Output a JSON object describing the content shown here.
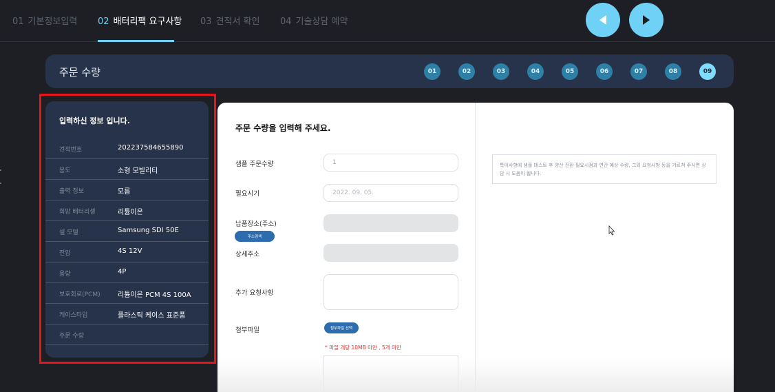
{
  "steps": [
    {
      "num": "01",
      "label": "기본정보입력"
    },
    {
      "num": "02",
      "label": "배터리팩 요구사항"
    },
    {
      "num": "03",
      "label": "견적서 확인"
    },
    {
      "num": "04",
      "label": "기술상담 예약"
    }
  ],
  "nav": {
    "prev_icon": "triangle-left-icon",
    "next_icon": "triangle-right-icon"
  },
  "section": {
    "title": "주문 수량",
    "pills": [
      "01",
      "02",
      "03",
      "04",
      "05",
      "06",
      "07",
      "08",
      "09"
    ],
    "active_pill": "09"
  },
  "info": {
    "title": "입력하신 정보 입니다.",
    "rows": [
      {
        "key": "견적번호",
        "value": "202237584655890"
      },
      {
        "key": "용도",
        "value": "소형 모빌리티"
      },
      {
        "key": "출력 정보",
        "value": "모름"
      },
      {
        "key": "희망 배터리셀",
        "value": "리튬이온"
      },
      {
        "key": "셀 모델",
        "value": "Samsung SDI 50E"
      },
      {
        "key": "전압",
        "value": "4S 12V"
      },
      {
        "key": "용량",
        "value": "4P"
      },
      {
        "key": "보호회로(PCM)",
        "value": "리튬이온 PCM 4S 100A"
      },
      {
        "key": "케이스타입",
        "value": "플라스틱 케이스 표준품"
      },
      {
        "key": "주문 수량",
        "value": ""
      }
    ]
  },
  "form": {
    "heading": "주문 수량을 입력해 주세요.",
    "sample_qty_label": "샘플 주문수량",
    "sample_qty_value": "1",
    "need_time_label": "필요시기",
    "need_time_value": "2022. 09. 05.",
    "delivery_label": "납품장소(주소)",
    "address_search_button": "주소검색",
    "detail_address_label": "상세주소",
    "extra_request_label": "추가 요청사항",
    "attachment_label": "첨부파일",
    "attachment_button": "첨부파일 선택",
    "attachment_warning": "* 파일 개당 10MB 미만 , 5개 미만",
    "notice_text": "특이사항에 샘플 테스트 후 양산 진환 필요시점과 연간 예상 수량, 그외 요청사항 등을 기르쳐 주시면 상담 시 도움이 됩니다."
  },
  "colors": {
    "accent": "#6fd1f5",
    "highlight": "#e8141b",
    "card": "#27334a",
    "background": "#1d1f24"
  }
}
